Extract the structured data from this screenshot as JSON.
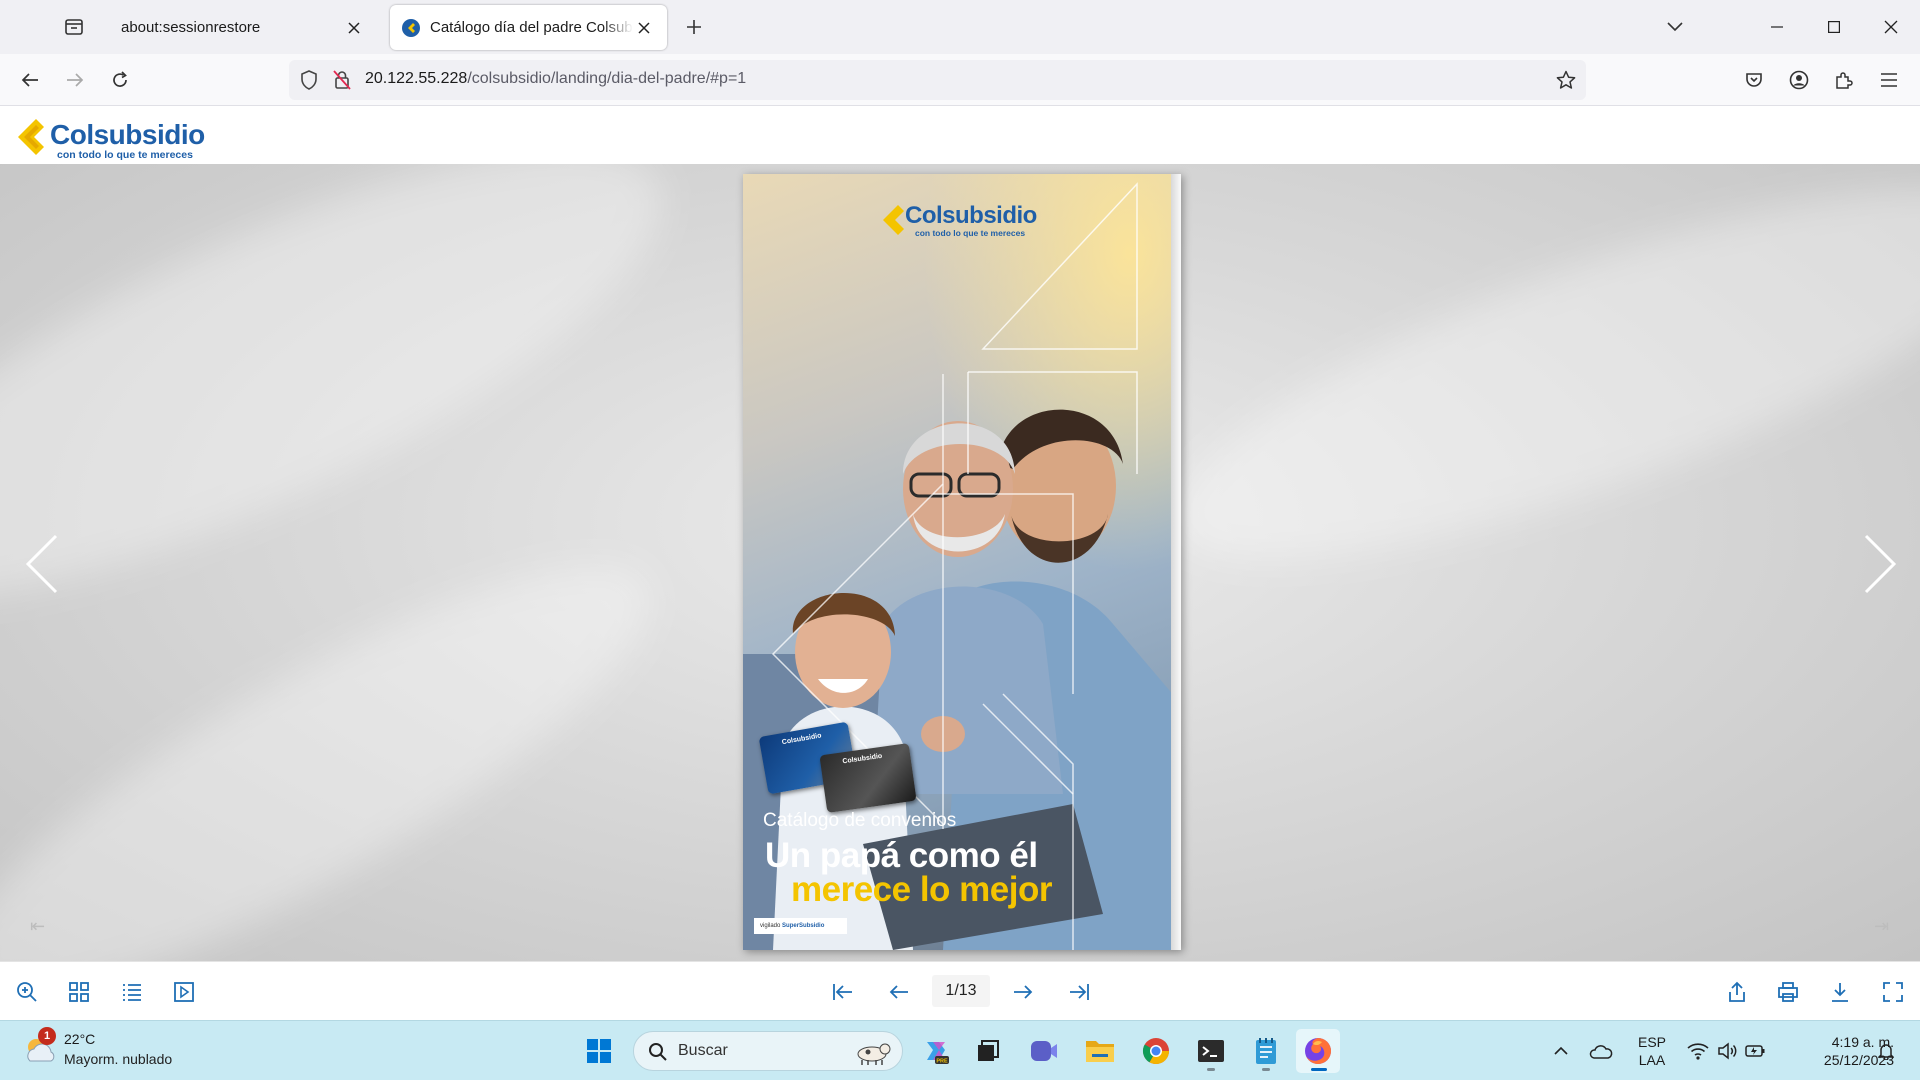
{
  "browser": {
    "tabs": [
      {
        "title": "about:sessionrestore",
        "active": false
      },
      {
        "title": "Catálogo día del padre Colsubsidio",
        "active": true
      }
    ],
    "url": {
      "host": "20.122.55.228",
      "path": "/colsubsidio/landing/dia-del-padre/#p=1"
    }
  },
  "site": {
    "logo_name": "Colsubsidio",
    "logo_tagline": "con todo lo que te mereces",
    "brand_colors": {
      "blue": "#1f5fa8",
      "yellow": "#f4c400"
    }
  },
  "catalog_page": {
    "logo_name": "Colsubsidio",
    "logo_tagline": "con todo lo que te mereces",
    "card_brand": "Colsubsidio",
    "subtitle": "Catálogo de convenios",
    "headline_1": "Un papá como él",
    "headline_2": "merece lo mejor",
    "footer_prefix": "vigilado",
    "footer_brand": "SuperSubsidio"
  },
  "viewer_toolbar": {
    "page_indicator": "1/13"
  },
  "taskbar": {
    "weather": {
      "badge": "1",
      "temp": "22°C",
      "desc": "Mayorm. nublado"
    },
    "search_label": "Buscar",
    "lang": {
      "line1": "ESP",
      "line2": "LAA"
    },
    "clock": {
      "time": "4:19 a. m.",
      "date": "25/12/2023"
    }
  }
}
